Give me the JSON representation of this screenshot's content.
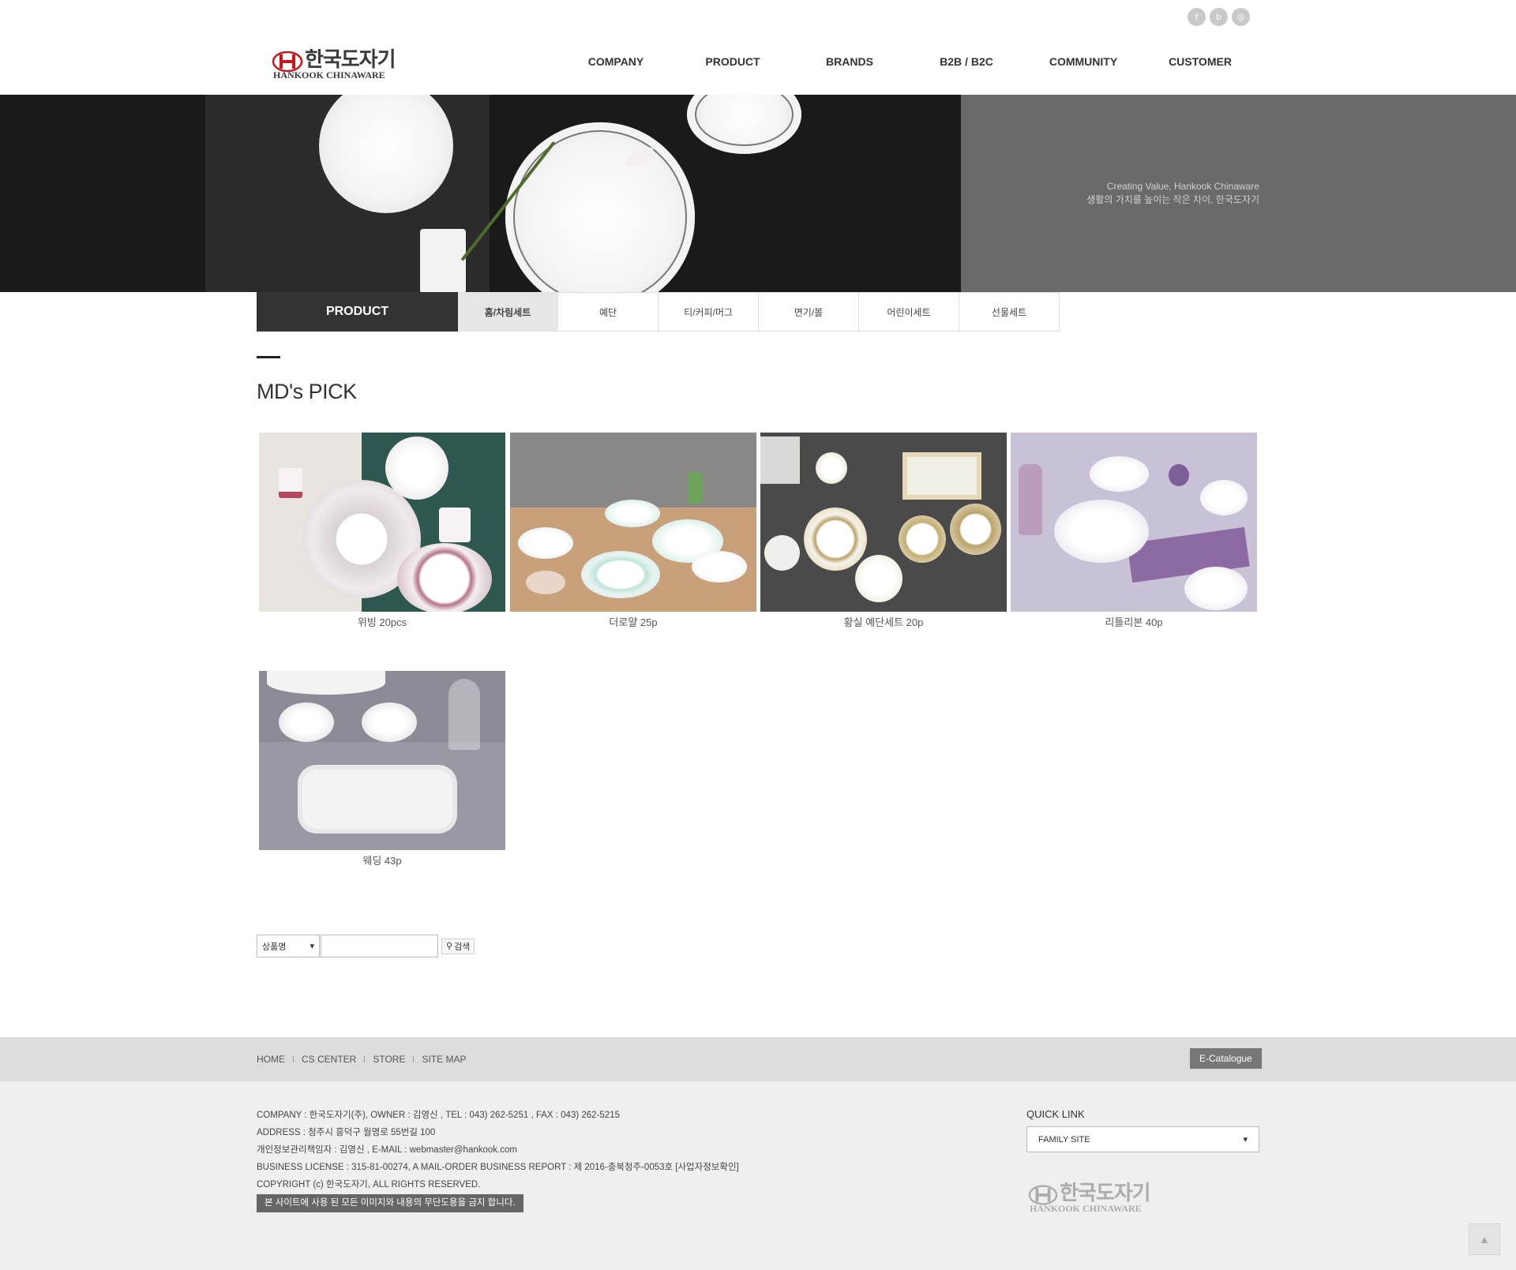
{
  "social": {
    "facebook": "f",
    "blog": "b",
    "instagram": "◎"
  },
  "logo": {
    "ko": "한국도자기",
    "en": "HANKOOK CHINAWARE"
  },
  "gnb": [
    "COMPANY",
    "PRODUCT",
    "BRANDS",
    "B2B / B2C",
    "COMMUNITY",
    "CUSTOMER"
  ],
  "hero": {
    "slogan_en": "Creating Value, Hankook Chinaware",
    "slogan_ko": "생활의 가치를 높이는 작은 차이, 한국도자기"
  },
  "subnav": {
    "title": "PRODUCT",
    "tabs": [
      "홈/차림세트",
      "예단",
      "티/커피/머그",
      "면기/볼",
      "어린이세트",
      "선물세트"
    ]
  },
  "page_title": "MD's PICK",
  "products": [
    {
      "name": "위빙 20pcs"
    },
    {
      "name": "더로얄 25p"
    },
    {
      "name": "황실 예단세트 20p"
    },
    {
      "name": "리틀리본 40p"
    },
    {
      "name": "웨딩 43p"
    }
  ],
  "search": {
    "field": "상품명",
    "button": "검색"
  },
  "footer": {
    "nav": [
      "HOME",
      "CS CENTER",
      "STORE",
      "SITE MAP"
    ],
    "ecatalogue": "E-Catalogue",
    "info": [
      "COMPANY : 한국도자기(주), OWNER : 김영신 , TEL : 043) 262-5251 , FAX : 043) 262-5215",
      "ADDRESS : 청주시 흥덕구 월명로 55번길 100",
      "개인정보관리책임자 : 김영신 , E-MAIL : webmaster@hankook.com",
      "BUSINESS LICENSE : 315-81-00274, A MAIL-ORDER BUSINESS REPORT : 제 2016-충북청주-0053호 [사업자정보확인]",
      "COPYRIGHT (c) 한국도자기, ALL RIGHTS RESERVED."
    ],
    "warning": "본 사이트에 사용 된 모든 이미지와 내용의 무단도용을 금지 합니다.",
    "quick_link": "QUICK LINK",
    "family_site": "FAMILY SITE"
  },
  "colors": {
    "dark": "#333333",
    "hero_gray": "#6a6a6a",
    "footer_bar": "#dcdcdc",
    "footer_bg": "#efefef",
    "brand_red": "#c8161d"
  }
}
